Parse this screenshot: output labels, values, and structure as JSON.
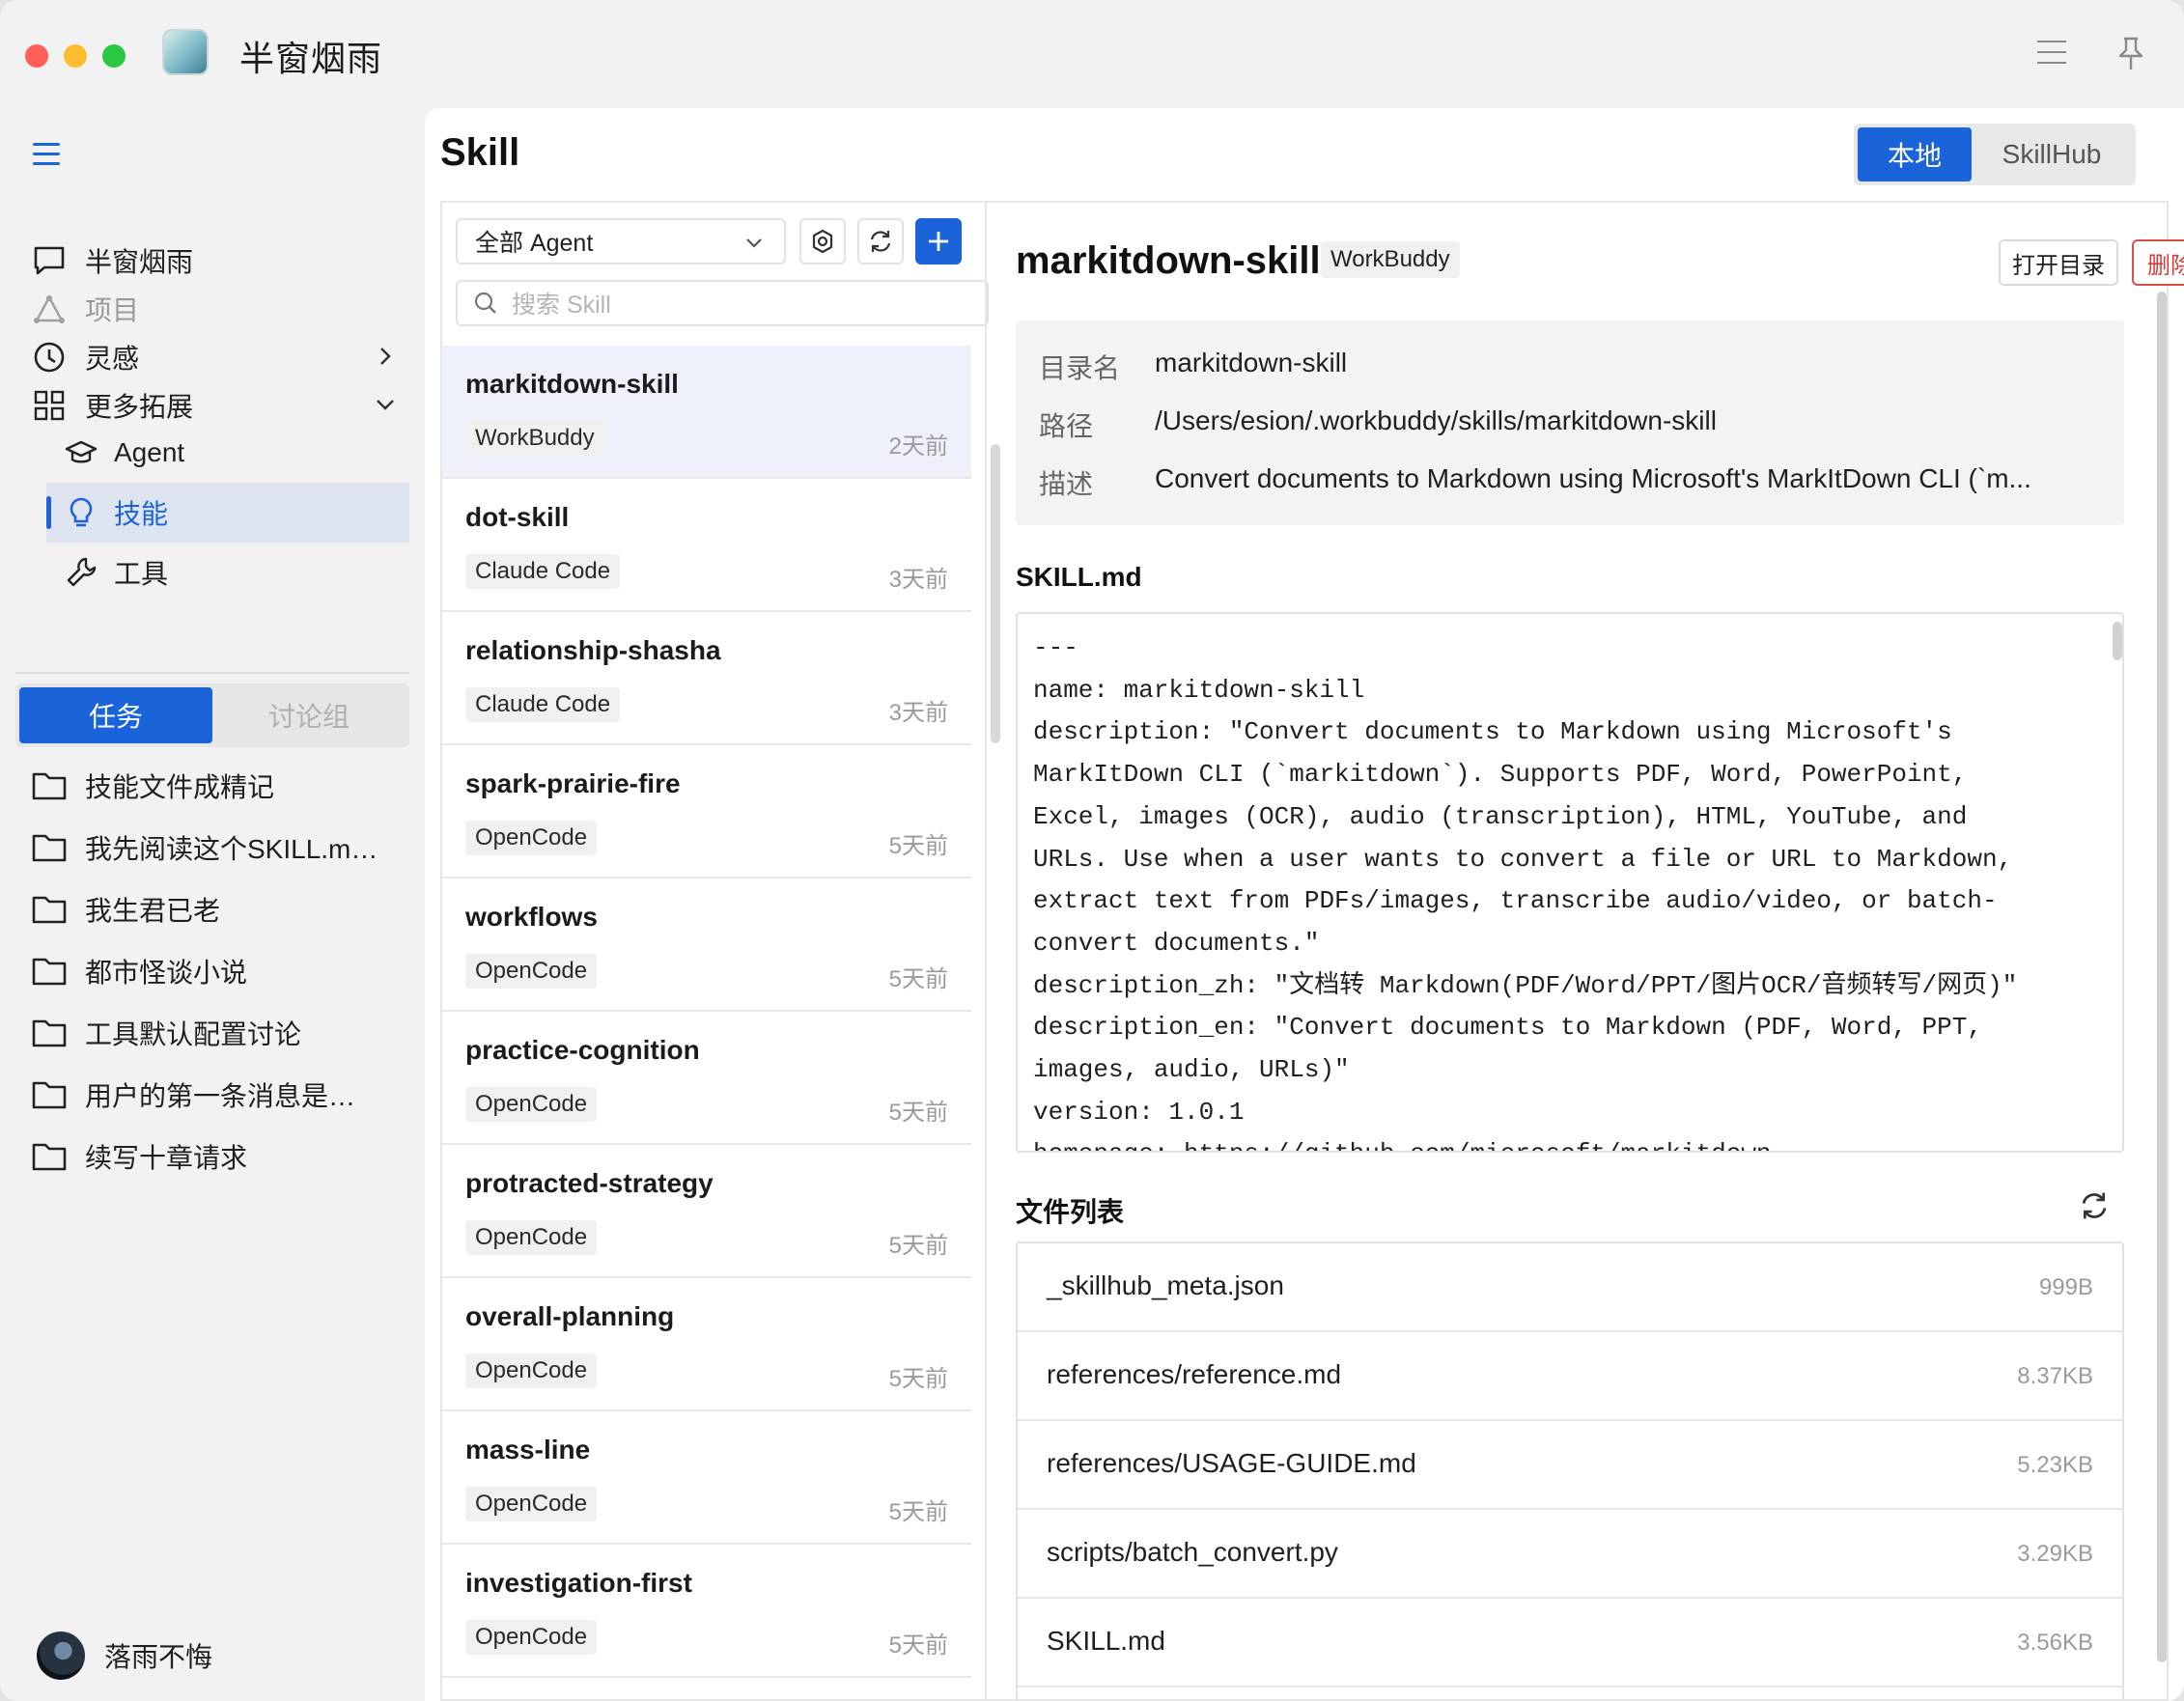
{
  "app": {
    "title": "半窗烟雨"
  },
  "sidebar": {
    "nav": [
      {
        "label": "半窗烟雨",
        "icon": "chat-bubble-icon"
      },
      {
        "label": "项目",
        "icon": "triangle-nodes-icon",
        "disabled": true
      },
      {
        "label": "灵感",
        "icon": "clock-icon"
      },
      {
        "label": "更多拓展",
        "icon": "grid-icon"
      }
    ],
    "sub": [
      {
        "label": "Agent",
        "icon": "graduation-cap-icon"
      },
      {
        "label": "技能",
        "icon": "lightbulb-icon",
        "active": true
      },
      {
        "label": "工具",
        "icon": "wrench-icon"
      }
    ],
    "tabs": {
      "tasks": "任务",
      "groups": "讨论组"
    },
    "tasks": [
      "技能文件成精记",
      "我先阅读这个SKILL.m…",
      "我生君已老",
      "都市怪谈小说",
      "工具默认配置讨论",
      "用户的第一条消息是…",
      "续写十章请求"
    ],
    "user": "落雨不悔"
  },
  "main": {
    "title": "Skill",
    "source_toggle": {
      "local": "本地",
      "hub": "SkillHub"
    }
  },
  "list": {
    "agent_select": "全部 Agent",
    "search_placeholder": "搜索 Skill",
    "skills": [
      {
        "name": "markitdown-skill",
        "agent": "WorkBuddy",
        "time": "2天前"
      },
      {
        "name": "dot-skill",
        "agent": "Claude Code",
        "time": "3天前"
      },
      {
        "name": "relationship-shasha",
        "agent": "Claude Code",
        "time": "3天前"
      },
      {
        "name": "spark-prairie-fire",
        "agent": "OpenCode",
        "time": "5天前"
      },
      {
        "name": "workflows",
        "agent": "OpenCode",
        "time": "5天前"
      },
      {
        "name": "practice-cognition",
        "agent": "OpenCode",
        "time": "5天前"
      },
      {
        "name": "protracted-strategy",
        "agent": "OpenCode",
        "time": "5天前"
      },
      {
        "name": "overall-planning",
        "agent": "OpenCode",
        "time": "5天前"
      },
      {
        "name": "mass-line",
        "agent": "OpenCode",
        "time": "5天前"
      },
      {
        "name": "investigation-first",
        "agent": "OpenCode",
        "time": "5天前"
      }
    ]
  },
  "detail": {
    "name": "markitdown-skill",
    "agent": "WorkBuddy",
    "open_dir": "打开目录",
    "delete": "删除",
    "meta": {
      "dir_label": "目录名",
      "dir": "markitdown-skill",
      "path_label": "路径",
      "path": "/Users/esion/.workbuddy/skills/markitdown-skill",
      "desc_label": "描述",
      "desc": "Convert documents to Markdown using Microsoft's MarkItDown CLI (`m..."
    },
    "skill_md_title": "SKILL.md",
    "skill_md": "---\nname: markitdown-skill\ndescription: \"Convert documents to Markdown using Microsoft's\nMarkItDown CLI (`markitdown`). Supports PDF, Word, PowerPoint,\nExcel, images (OCR), audio (transcription), HTML, YouTube, and\nURLs. Use when a user wants to convert a file or URL to Markdown,\nextract text from PDFs/images, transcribe audio/video, or batch-\nconvert documents.\"\ndescription_zh: \"文档转 Markdown(PDF/Word/PPT/图片OCR/音频转写/网页)\"\ndescription_en: \"Convert documents to Markdown (PDF, Word, PPT,\nimages, audio, URLs)\"\nversion: 1.0.1\nhomepage: https://github.com/microsoft/markitdown",
    "files_title": "文件列表",
    "files": [
      {
        "name": "_skillhub_meta.json",
        "size": "999B"
      },
      {
        "name": "references/reference.md",
        "size": "8.37KB"
      },
      {
        "name": "references/USAGE-GUIDE.md",
        "size": "5.23KB"
      },
      {
        "name": "scripts/batch_convert.py",
        "size": "3.29KB"
      },
      {
        "name": "SKILL.md",
        "size": "3.56KB"
      }
    ]
  },
  "colors": {
    "accent": "#1a63d8",
    "danger": "#d83a3a"
  }
}
